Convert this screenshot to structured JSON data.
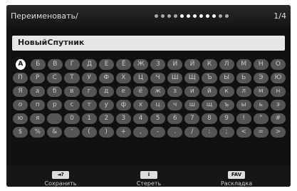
{
  "header": {
    "title": "Переименовать/",
    "page_indicator": "1/4"
  },
  "input": {
    "value": "НовыйСпутник"
  },
  "keyboard": {
    "rows": [
      [
        "А",
        "Б",
        "В",
        "Г",
        "Д",
        "Е",
        "Ё",
        "Ж",
        "З",
        "И",
        "Й",
        "К",
        "Л",
        "М",
        "Н",
        "О"
      ],
      [
        "П",
        "Р",
        "С",
        "Т",
        "У",
        "Ф",
        "Х",
        "Ц",
        "Ч",
        "Ш",
        "Щ",
        "Ъ",
        "Ы",
        "Ь",
        "Э",
        "Ю"
      ],
      [
        "Я",
        "а",
        "б",
        "в",
        "г",
        "д",
        "е",
        "ё",
        "ж",
        "з",
        "и",
        "й",
        "к",
        "л",
        "м",
        "н"
      ],
      [
        "о",
        "п",
        "р",
        "с",
        "т",
        "у",
        "ф",
        "х",
        "ц",
        "ч",
        "ш",
        "щ",
        "ъ",
        "ы",
        "ь",
        "э"
      ],
      [
        "ю",
        "я",
        " ",
        "0",
        "1",
        "2",
        "3",
        "4",
        "5",
        "6",
        "7",
        "8",
        "9",
        "!",
        "\"",
        "#"
      ],
      [
        "$",
        "%",
        "&",
        "'",
        "(",
        ")",
        "+",
        ",",
        "-",
        ".",
        "/",
        ":",
        ";",
        "<",
        "=",
        ">"
      ]
    ],
    "selected": "А"
  },
  "footer": [
    {
      "badge": "◄?",
      "label": "Сохранить"
    },
    {
      "badge": "i",
      "label": "Стереть"
    },
    {
      "badge": "FAV",
      "label": "Раскладка"
    }
  ]
}
